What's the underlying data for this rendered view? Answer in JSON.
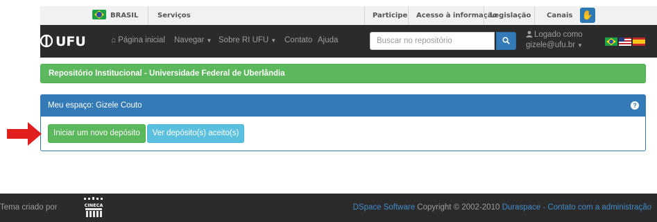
{
  "gov_bar": {
    "country": "BRASIL",
    "services": "Serviços",
    "links": [
      "Participe",
      "Acesso à informação",
      "Legislação",
      "Canais"
    ]
  },
  "navbar": {
    "brand": "UFU",
    "items": [
      {
        "label": "Página inicial",
        "icon": "home-icon"
      },
      {
        "label": "Navegar",
        "dropdown": true
      },
      {
        "label": "Sobre RI UFU",
        "dropdown": true
      },
      {
        "label": "Contato"
      },
      {
        "label": "Ajuda"
      }
    ],
    "search_placeholder": "Buscar no repositório",
    "user_line1": "Logado como",
    "user_line2": "gizele@ufu.br"
  },
  "banner": {
    "text": "Repositório Institucional - Universidade Federal de Uberlândia"
  },
  "panel": {
    "heading": "Meu espaço: Gizele Couto",
    "buttons": {
      "new_deposit": "Iniciar um novo depósito",
      "view_accepted": "Ver depósito(s) aceito(s)"
    }
  },
  "footer": {
    "left_text": "Tema criado por",
    "logo_label": "CINECA",
    "dspace": "DSpace Software",
    "copyright": " Copyright © 2002-2010 ",
    "duraspace": "Duraspace",
    "separator": " - ",
    "contact": "Contato com a administração"
  },
  "colors": {
    "navbar_bg": "#2b2b2b",
    "success": "#5cb85c",
    "primary": "#337ab7",
    "info": "#5bc0de",
    "annotation_arrow": "#e01e1e"
  }
}
